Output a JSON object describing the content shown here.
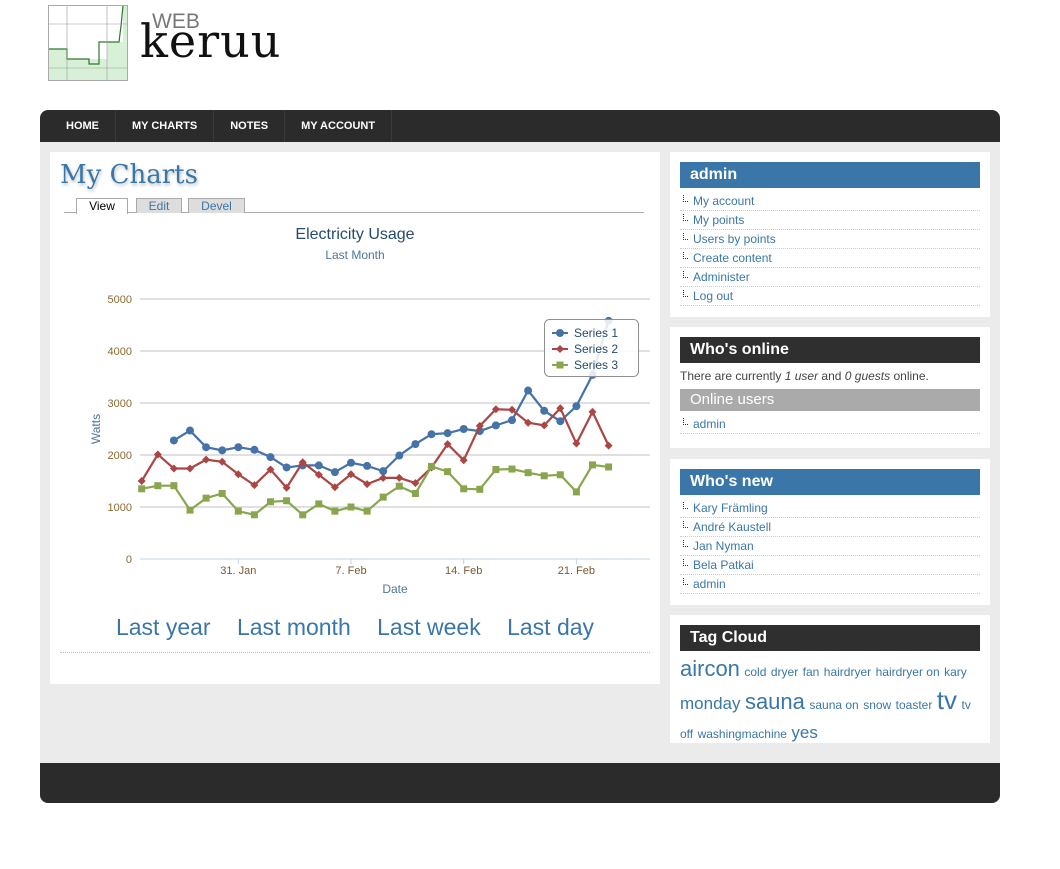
{
  "header": {
    "brand_small": "WEB",
    "brand_name": "keruu"
  },
  "nav": [
    "HOME",
    "MY CHARTS",
    "NOTES",
    "MY ACCOUNT"
  ],
  "main": {
    "title": "My Charts",
    "tabs": [
      "View",
      "Edit",
      "Devel"
    ],
    "active_tab": "View",
    "ranges": [
      "Last year",
      "Last month",
      "Last week",
      "Last day"
    ]
  },
  "chart_data": {
    "type": "line",
    "title": "Electricity Usage",
    "subtitle": "Last Month",
    "xlabel": "Date",
    "ylabel": "Watts",
    "ylim": [
      0,
      5000
    ],
    "yticks": [
      0,
      1000,
      2000,
      3000,
      4000,
      5000
    ],
    "grid": true,
    "legend": "top-right",
    "xticks": [
      {
        "at": "31 Jan",
        "label": "31. Jan"
      },
      {
        "at": "7 Feb",
        "label": "7. Feb"
      },
      {
        "at": "14 Feb",
        "label": "14. Feb"
      },
      {
        "at": "21 Feb",
        "label": "21. Feb"
      }
    ],
    "x": [
      "25 Jan",
      "26 Jan",
      "27 Jan",
      "28 Jan",
      "29 Jan",
      "30 Jan",
      "31 Jan",
      "1 Feb",
      "2 Feb",
      "3 Feb",
      "4 Feb",
      "5 Feb",
      "6 Feb",
      "7 Feb",
      "8 Feb",
      "9 Feb",
      "10 Feb",
      "11 Feb",
      "12 Feb",
      "13 Feb",
      "14 Feb",
      "15 Feb",
      "16 Feb",
      "17 Feb",
      "18 Feb",
      "19 Feb",
      "20 Feb",
      "21 Feb",
      "22 Feb",
      "23 Feb"
    ],
    "series": [
      {
        "name": "Series 1",
        "color": "#4572a7",
        "marker": "circle",
        "values": [
          null,
          null,
          2280,
          2470,
          2150,
          2090,
          2150,
          2100,
          1960,
          1760,
          1800,
          1800,
          1670,
          1850,
          1790,
          1690,
          1990,
          2210,
          2400,
          2420,
          2500,
          2460,
          2570,
          2670,
          3240,
          2850,
          2650,
          2940,
          3540,
          4580
        ]
      },
      {
        "name": "Series 2",
        "color": "#aa4643",
        "marker": "diamond",
        "values": [
          1500,
          2010,
          1740,
          1740,
          1910,
          1870,
          1630,
          1420,
          1720,
          1370,
          1860,
          1620,
          1380,
          1630,
          1440,
          1560,
          1560,
          1460,
          1760,
          2210,
          1900,
          2560,
          2880,
          2870,
          2620,
          2570,
          2900,
          2220,
          2830,
          2180
        ]
      },
      {
        "name": "Series 3",
        "color": "#89a54e",
        "marker": "square",
        "values": [
          1350,
          1410,
          1410,
          940,
          1170,
          1260,
          920,
          850,
          1100,
          1120,
          850,
          1060,
          920,
          1000,
          920,
          1190,
          1400,
          1260,
          1780,
          1680,
          1350,
          1340,
          1720,
          1730,
          1660,
          1600,
          1620,
          1290,
          1810,
          1770
        ]
      }
    ]
  },
  "sidebar": {
    "admin": {
      "title": "admin",
      "items": [
        "My account",
        "My points",
        "Users by points",
        "Create content",
        "Administer",
        "Log out"
      ]
    },
    "online": {
      "title": "Who's online",
      "text_pre": "There are currently ",
      "users": "1 user",
      "text_mid": " and ",
      "guests": "0 guests",
      "text_post": " online.",
      "subtitle": "Online users",
      "items": [
        "admin"
      ]
    },
    "new": {
      "title": "Who's new",
      "items": [
        "Kary Främling",
        "André Kaustell",
        "Jan Nyman",
        "Bela Patkai",
        "admin"
      ]
    },
    "tags": {
      "title": "Tag Cloud",
      "items": [
        {
          "t": "aircon",
          "s": 22
        },
        {
          "t": "cold",
          "s": 12
        },
        {
          "t": "dryer",
          "s": 12
        },
        {
          "t": "fan",
          "s": 12
        },
        {
          "t": "hairdryer",
          "s": 12
        },
        {
          "t": "hairdryer on",
          "s": 12
        },
        {
          "t": "kary",
          "s": 12
        },
        {
          "t": "monday",
          "s": 17
        },
        {
          "t": "sauna",
          "s": 22
        },
        {
          "t": "sauna on",
          "s": 12
        },
        {
          "t": "snow",
          "s": 12
        },
        {
          "t": "toaster",
          "s": 12
        },
        {
          "t": "tv",
          "s": 26
        },
        {
          "t": "tv off",
          "s": 12
        },
        {
          "t": "washingmachine",
          "s": 12
        },
        {
          "t": "yes",
          "s": 17
        }
      ]
    }
  },
  "colors": {
    "accent": "#3a77a8",
    "dark": "#2b2b2b"
  }
}
